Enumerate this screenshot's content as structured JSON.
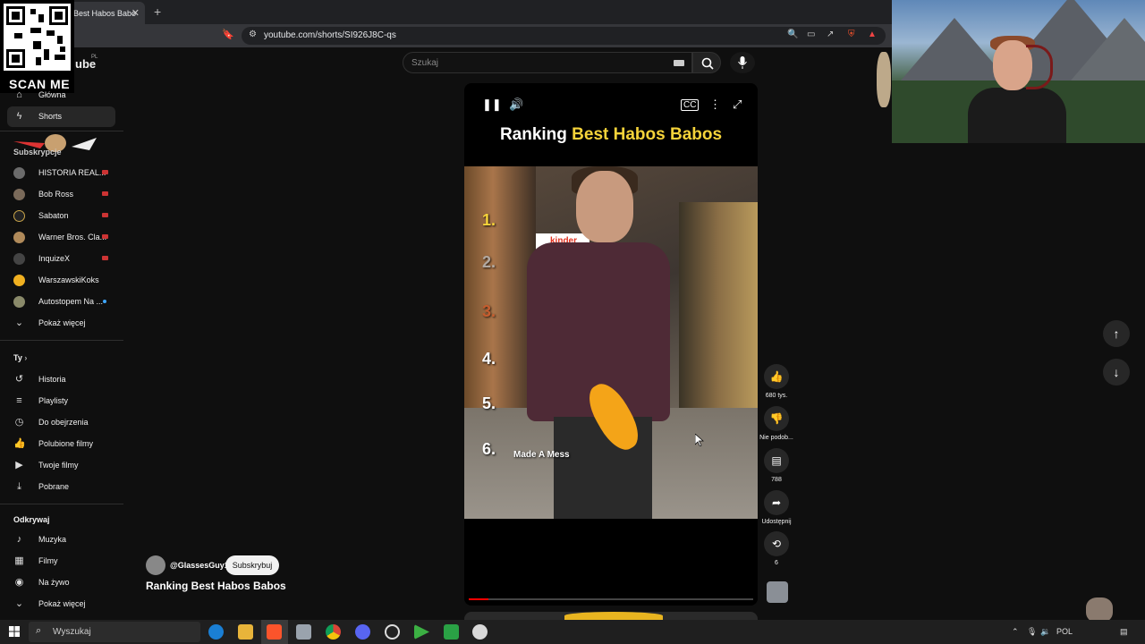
{
  "browser": {
    "tab_title": "Best Habos Babo",
    "new_tab": "+",
    "url": "youtube.com/shorts/SI926J8C-qs"
  },
  "qr": {
    "label": "SCAN ME"
  },
  "logo": {
    "suffix": "ube",
    "region": "PL"
  },
  "sidebar": {
    "nav": [
      {
        "label": "Główna",
        "icon": "home-icon"
      },
      {
        "label": "Shorts",
        "icon": "shorts-icon",
        "active": true
      }
    ],
    "subscriptions_title": "Subskrypcje",
    "subscriptions": [
      {
        "label": "HISTORIA REAL...",
        "color": "#6b6b6b",
        "live": true
      },
      {
        "label": "Bob Ross",
        "color": "#7a6a5a",
        "live": true
      },
      {
        "label": "Sabaton",
        "color": "#222222",
        "live": true
      },
      {
        "label": "Warner Bros. Cla...",
        "color": "#b08a5a",
        "live": true
      },
      {
        "label": "InquizeX",
        "color": "#444444",
        "live": true
      },
      {
        "label": "WarszawskiKoks",
        "color": "#f0b020",
        "live": false
      },
      {
        "label": "Autostopem Na ...",
        "color": "#8a8a6a",
        "live": false
      }
    ],
    "show_more": "Pokaż więcej",
    "you_title": "Ty",
    "you_items": [
      {
        "label": "Historia",
        "icon": "history-icon"
      },
      {
        "label": "Playlisty",
        "icon": "playlist-icon"
      },
      {
        "label": "Do obejrzenia",
        "icon": "clock-icon"
      },
      {
        "label": "Polubione filmy",
        "icon": "thumb-up-icon"
      },
      {
        "label": "Twoje filmy",
        "icon": "video-icon"
      },
      {
        "label": "Pobrane",
        "icon": "download-icon"
      }
    ],
    "explore_title": "Odkrywaj",
    "explore_items": [
      {
        "label": "Muzyka",
        "icon": "music-icon"
      },
      {
        "label": "Filmy",
        "icon": "film-icon"
      },
      {
        "label": "Na żywo",
        "icon": "live-icon"
      },
      {
        "label": "Pokaż więcej",
        "icon": "chevron-down-icon"
      }
    ]
  },
  "search": {
    "placeholder": "Szukaj"
  },
  "video": {
    "title_prefix": "Ranking ",
    "title_highlight": "Best Habos Babos",
    "kinder": "kinder",
    "ranks": [
      "1.",
      "2.",
      "3.",
      "4.",
      "5.",
      "6."
    ],
    "rank6_label": "Made A Mess",
    "progress": 0.07
  },
  "actions": {
    "likes": "680 tys.",
    "dislike": "Nie podob...",
    "comments": "788",
    "share": "Udostępnij",
    "remix": "6"
  },
  "channel": {
    "handle": "@GlassesGuy1",
    "subscribe": "Subskrybuj",
    "short_title": "Ranking Best Habos Babos"
  },
  "taskbar": {
    "search": "Wyszukaj",
    "lang": "POL"
  }
}
